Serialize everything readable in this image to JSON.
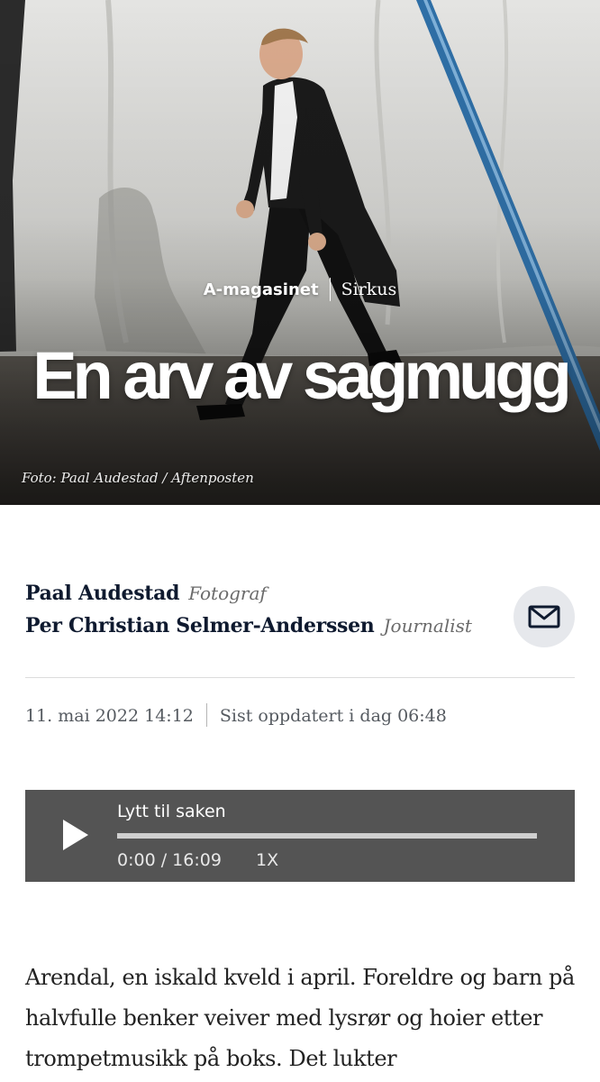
{
  "hero": {
    "kicker_section": "A-magasinet",
    "kicker_topic": "Sirkus",
    "headline": "En arv av sagmugg",
    "photo_credit": "Foto: Paal Audestad / Aftenposten"
  },
  "byline": {
    "authors": [
      {
        "name": "Paal Audestad",
        "role": "Fotograf"
      },
      {
        "name": "Per Christian Selmer-Anderssen",
        "role": "Journalist"
      }
    ],
    "contact_icon": "envelope-icon"
  },
  "dates": {
    "published": "11. mai 2022 14:12",
    "updated": "Sist oppdatert i dag 06:48"
  },
  "audio": {
    "title": "Lytt til saken",
    "time": "0:00 / 16:09",
    "speed": "1X",
    "progress": 0,
    "play_icon": "play-icon"
  },
  "article": {
    "intro": "Arendal, en iskald kveld i april. Foreldre og barn på halvfulle benker veiver med lysrør og hoier etter trompetmusikk på boks. Det lukter"
  },
  "colors": {
    "ink": "#0f1a2f",
    "muted": "#6b6b6b",
    "player_bg": "#545454",
    "mail_button_bg": "#e6e8ec"
  }
}
